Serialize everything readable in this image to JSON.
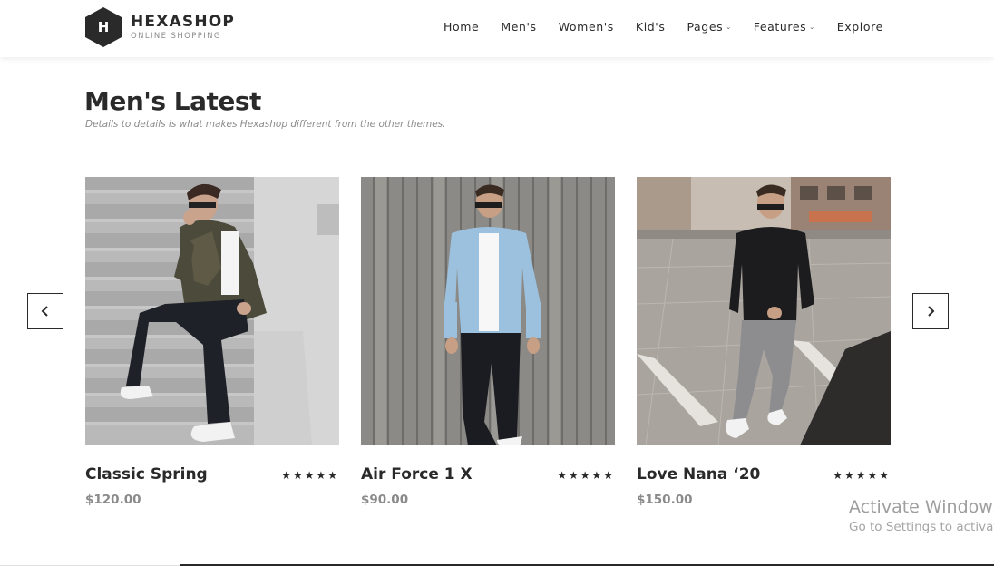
{
  "brand": {
    "logo_letter": "H",
    "name": "HEXASHOP",
    "tagline": "ONLINE SHOPPING"
  },
  "nav": {
    "items": [
      {
        "label": "Home",
        "dropdown": false
      },
      {
        "label": "Men's",
        "dropdown": false
      },
      {
        "label": "Women's",
        "dropdown": false
      },
      {
        "label": "Kid's",
        "dropdown": false
      },
      {
        "label": "Pages",
        "dropdown": true
      },
      {
        "label": "Features",
        "dropdown": true
      },
      {
        "label": "Explore",
        "dropdown": false
      }
    ]
  },
  "section": {
    "title": "Men's Latest",
    "subtitle": "Details to details is what makes Hexashop different from the other themes."
  },
  "carousel": {
    "prev_icon": "chevron-left-icon",
    "next_icon": "chevron-right-icon",
    "products": [
      {
        "name": "Classic Spring",
        "price": "$120.00",
        "stars": "★★★★★",
        "rating": 5
      },
      {
        "name": "Air Force 1 X",
        "price": "$90.00",
        "stars": "★★★★★",
        "rating": 5
      },
      {
        "name": "Love Nana ‘20",
        "price": "$150.00",
        "stars": "★★★★★",
        "rating": 5
      }
    ]
  },
  "watermark": {
    "title": "Activate Windows",
    "subtitle": "Go to Settings to activate Windows."
  },
  "colors": {
    "text": "#2a2a2a",
    "muted": "#8a8a8a",
    "logo_bg": "#2a2a2a"
  }
}
